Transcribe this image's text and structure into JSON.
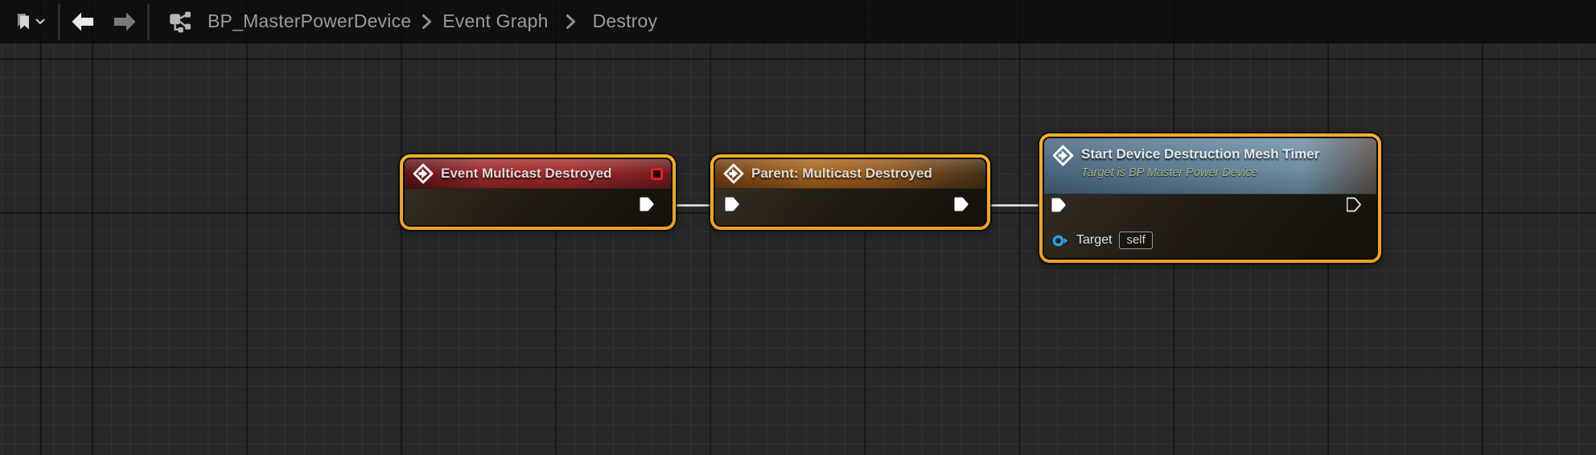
{
  "toolbar": {
    "icons": [
      "bookmark-icon",
      "chevron-down-icon",
      "arrow-left-icon",
      "arrow-right-icon",
      "graph-hierarchy-icon"
    ],
    "breadcrumb": {
      "items": [
        "BP_MasterPowerDevice",
        "Event Graph",
        "Destroy"
      ]
    }
  },
  "graph": {
    "nodes": [
      {
        "title": "Event Multicast Destroyed",
        "kind": "event",
        "header_color": "#a32b2c",
        "badges": [
          "event-override-badge"
        ],
        "pins": {
          "outputs": [
            {
              "type": "exec",
              "connected": true
            }
          ]
        }
      },
      {
        "title": "Parent: Multicast Destroyed",
        "kind": "parent-call",
        "header_color": "#a8671e",
        "pins": {
          "inputs": [
            {
              "type": "exec",
              "connected": true
            }
          ],
          "outputs": [
            {
              "type": "exec",
              "connected": true
            }
          ]
        }
      },
      {
        "title": "Start Device Destruction Mesh Timer",
        "subtitle": "Target is BP Master Power Device",
        "kind": "function-call",
        "header_color": "#5d7f97",
        "pins": {
          "inputs": [
            {
              "type": "exec",
              "connected": true
            },
            {
              "type": "object",
              "label": "Target",
              "value": "self",
              "connected": false
            }
          ],
          "outputs": [
            {
              "type": "exec",
              "connected": false
            }
          ]
        }
      }
    ]
  },
  "colors": {
    "selection_accent": "#f0a42c",
    "canvas_bg": "#282828",
    "grid_minor": "#333333",
    "topbar_bg": "#0a0a0a",
    "breadcrumb_text": "#9b9b9b",
    "wire": "#ededed",
    "exec_pin": "#ffffff",
    "object_pin": "#27a3e8",
    "subtitle_text": "#a6b382",
    "event_badge": "#f21c1c"
  }
}
